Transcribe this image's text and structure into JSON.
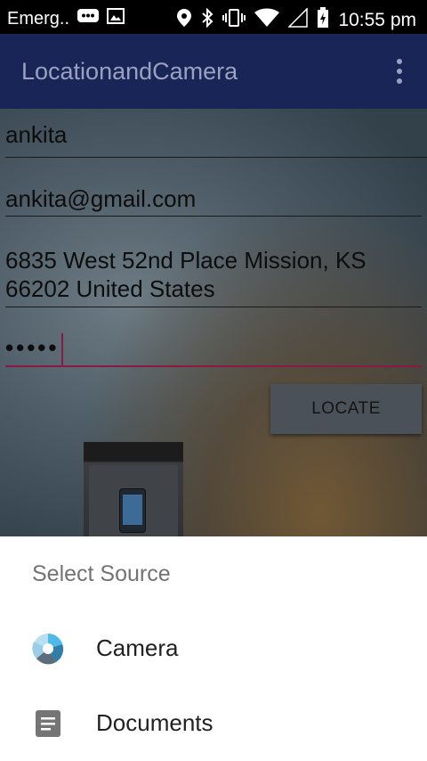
{
  "status_bar": {
    "carrier": "Emerg..",
    "time": "10:55 pm",
    "icons": [
      "message-icon",
      "image-icon",
      "location-icon",
      "bluetooth-icon",
      "vibrate-icon",
      "wifi-icon",
      "signal-icon",
      "battery-icon"
    ]
  },
  "app_bar": {
    "title": "LocationandCamera",
    "menu_icon": "overflow-menu-icon"
  },
  "form": {
    "name": "ankita",
    "email": "ankita@gmail.com",
    "address_line1": "6835 West 52nd Place  Mission, KS",
    "address_line2": "66202 United States",
    "password_mask": "•••••"
  },
  "locate_button": {
    "label": "LOCATE"
  },
  "sheet": {
    "title": "Select Source",
    "options": [
      {
        "label": "Camera",
        "icon": "camera-aperture-icon"
      },
      {
        "label": "Documents",
        "icon": "document-icon"
      }
    ]
  },
  "colors": {
    "app_bar": "#1a2557",
    "accent": "#8a1a44",
    "sheet_background": "#ffffff"
  }
}
